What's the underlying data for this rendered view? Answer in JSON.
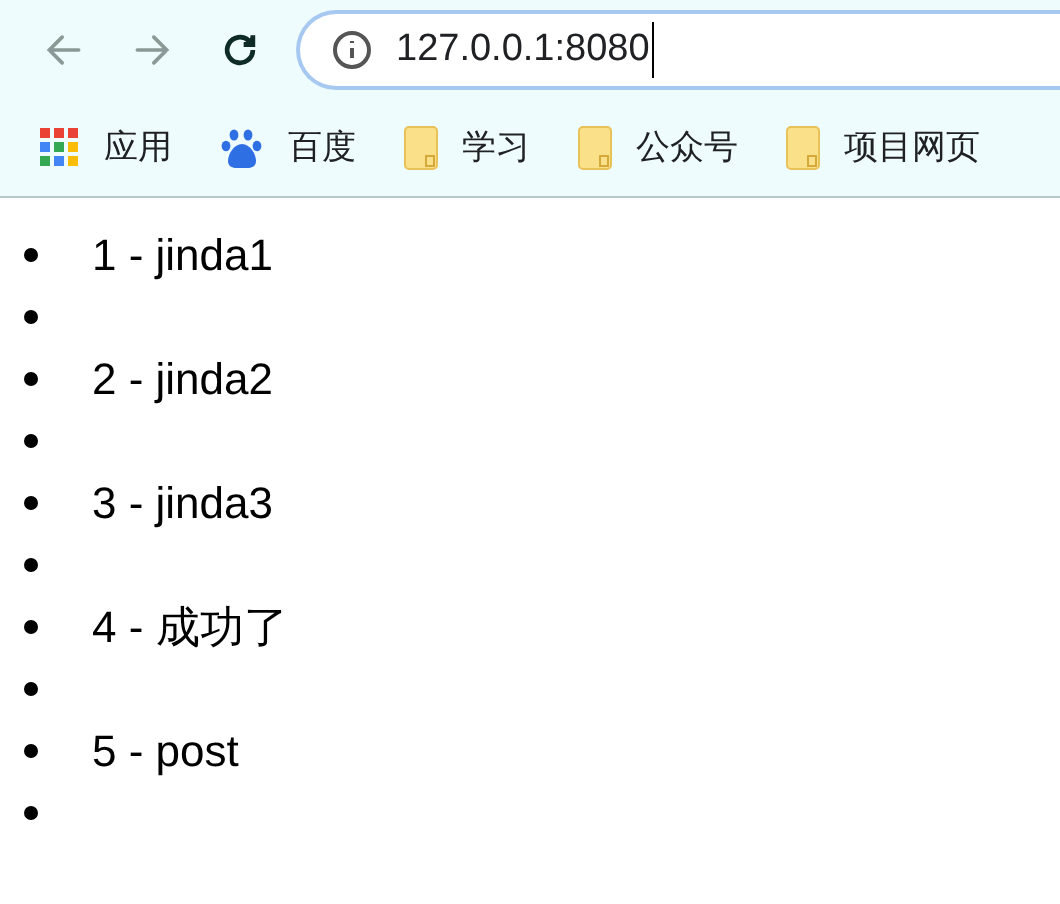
{
  "toolbar": {
    "back": {
      "disabled": true
    },
    "forward": {
      "disabled": true
    },
    "address": {
      "value": "127.0.0.1:8080"
    }
  },
  "bookmarks": [
    {
      "kind": "apps",
      "label": "应用"
    },
    {
      "kind": "paw",
      "label": "百度"
    },
    {
      "kind": "folder",
      "label": "学习"
    },
    {
      "kind": "folder",
      "label": "公众号"
    },
    {
      "kind": "folder",
      "label": "项目网页"
    }
  ],
  "list": [
    {
      "kind": "text",
      "text": "1 - jinda1"
    },
    {
      "kind": "empty"
    },
    {
      "kind": "text",
      "text": "2 - jinda2"
    },
    {
      "kind": "empty"
    },
    {
      "kind": "text",
      "text": "3 - jinda3"
    },
    {
      "kind": "empty"
    },
    {
      "kind": "text",
      "text": "4 - 成功了"
    },
    {
      "kind": "empty"
    },
    {
      "kind": "text",
      "text": "5 - post"
    },
    {
      "kind": "empty"
    }
  ]
}
